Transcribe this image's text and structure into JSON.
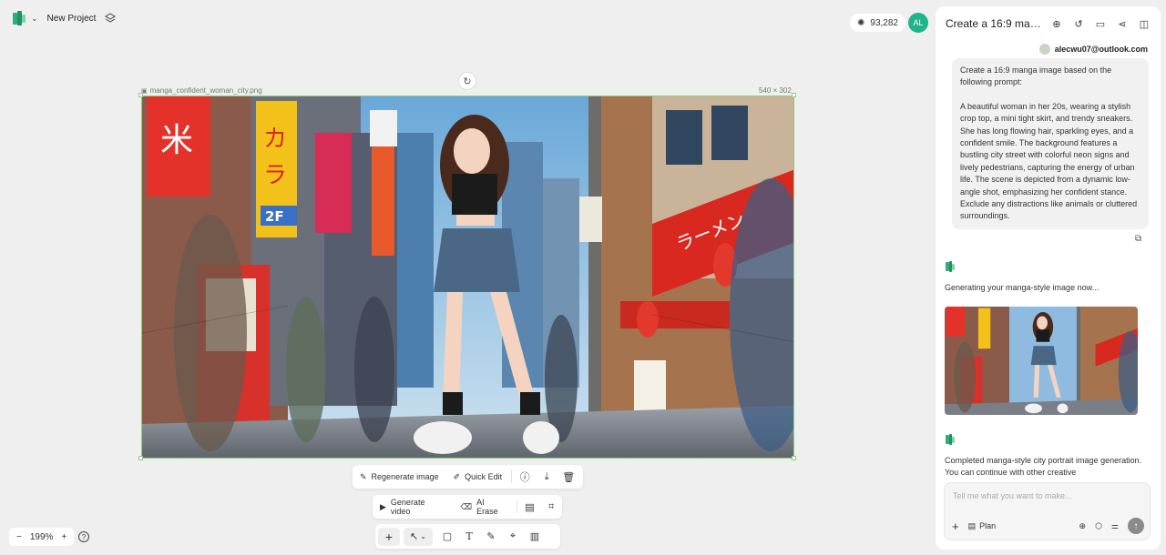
{
  "project": {
    "name": "New Project"
  },
  "credits": "93,282",
  "avatar_initials": "AL",
  "canvas": {
    "file_name": "manga_confident_woman_city.png",
    "dimensions": "540 × 302"
  },
  "image_toolbar": {
    "regenerate": "Regenerate image",
    "quick_edit": "Quick Edit"
  },
  "secondary_toolbar": {
    "generate_video": "Generate video",
    "ai_erase": "AI Erase"
  },
  "zoom": {
    "level": "199%"
  },
  "panel": {
    "title": "Create a 16:9 manga...",
    "user_email": "alecwu07@outlook.com",
    "prompt_line1": "Create a 16:9 manga image based on the following prompt:",
    "prompt_line2": "A beautiful woman in her 20s, wearing a stylish crop top, a mini tight skirt, and trendy sneakers. She has long flowing hair, sparkling eyes, and a confident smile. The background features a bustling city street with colorful neon signs and lively pedestrians, capturing the energy of urban life. The scene is depicted from a dynamic low-angle shot, emphasizing her confident stance. Exclude any distractions like animals or cluttered surroundings.",
    "status_generating": "Generating your manga-style image now...",
    "status_completed": "Completed manga-style city portrait image generation. You can continue with other creative",
    "input_placeholder": "Tell me what you want to make...",
    "plan_label": "Plan"
  },
  "colors": {
    "accent": "#1fb58a",
    "selection": "#8ccf7a"
  }
}
